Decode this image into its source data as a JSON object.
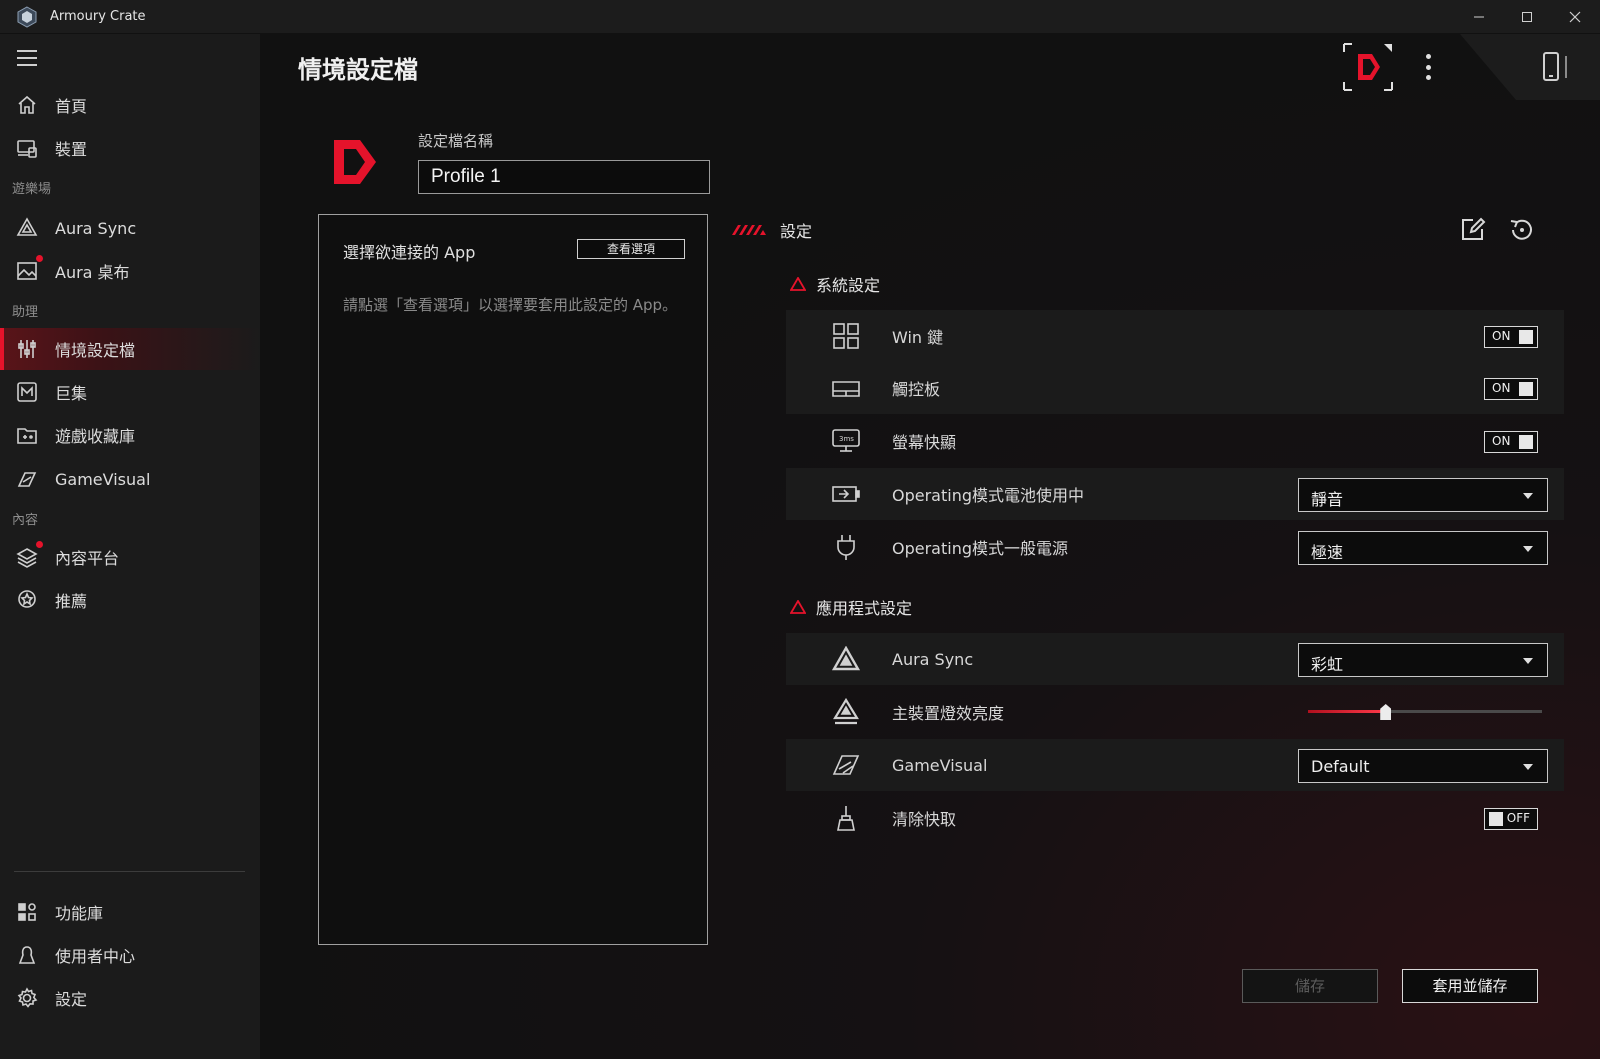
{
  "window": {
    "title": "Armoury Crate"
  },
  "sidebar": {
    "items_top": [
      {
        "label": "首頁",
        "icon": "home-icon"
      },
      {
        "label": "裝置",
        "icon": "device-icon"
      }
    ],
    "section_playground": "遊樂場",
    "items_playground": [
      {
        "label": "Aura Sync",
        "icon": "aura-sync-icon"
      },
      {
        "label": "Aura 桌布",
        "icon": "wallpaper-icon"
      }
    ],
    "section_assistant": "助理",
    "items_assistant": [
      {
        "label": "情境設定檔",
        "icon": "scenario-profile-icon"
      },
      {
        "label": "巨集",
        "icon": "macro-icon"
      },
      {
        "label": "遊戲收藏庫",
        "icon": "game-library-icon"
      },
      {
        "label": "GameVisual",
        "icon": "gamevisual-icon"
      }
    ],
    "section_content": "內容",
    "items_content": [
      {
        "label": "內容平台",
        "icon": "content-platform-icon"
      },
      {
        "label": "推薦",
        "icon": "recommend-icon"
      }
    ],
    "items_bottom": [
      {
        "label": "功能庫",
        "icon": "feature-library-icon"
      },
      {
        "label": "使用者中心",
        "icon": "user-center-icon"
      },
      {
        "label": "設定",
        "icon": "settings-gear-icon"
      }
    ]
  },
  "main": {
    "title": "情境設定檔",
    "profile_name_label": "設定檔名稱",
    "profile_name_value": "Profile 1",
    "app_panel": {
      "title": "選擇欲連接的 App",
      "view_button": "查看選項",
      "hint": "請點選「查看選項」以選擇要套用此設定的 App。"
    },
    "settings_label": "設定",
    "system_group": {
      "title": "系統設定",
      "rows": [
        {
          "label": "Win 鍵",
          "state": "ON"
        },
        {
          "label": "觸控板",
          "state": "ON"
        },
        {
          "label": "螢幕快顯",
          "state": "ON"
        },
        {
          "label": "Operating模式電池使用中",
          "value": "靜音"
        },
        {
          "label": "Operating模式一般電源",
          "value": "極速"
        }
      ]
    },
    "app_group": {
      "title": "應用程式設定",
      "rows": [
        {
          "label": "Aura Sync",
          "value": "彩虹"
        },
        {
          "label": "主裝置燈效亮度",
          "level": 0.33
        },
        {
          "label": "GameVisual",
          "value": "Default"
        },
        {
          "label": "清除快取",
          "state": "OFF"
        }
      ]
    },
    "buttons": {
      "save": "儲存",
      "apply_save": "套用並儲存"
    }
  },
  "colors": {
    "accent": "#e5132b",
    "background": "#101010",
    "sidebar": "#1b1b1b"
  }
}
